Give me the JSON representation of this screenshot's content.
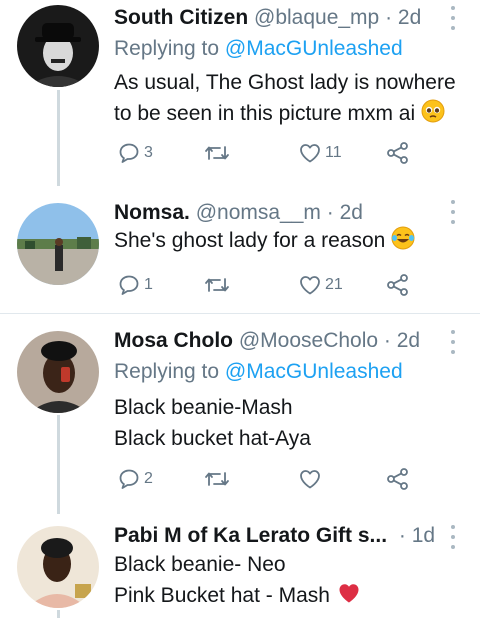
{
  "tweets": [
    {
      "name": "South Citizen",
      "handle": "@blaque_mp",
      "dot": "·",
      "time": "2d",
      "replying_label": "Replying to",
      "replying_to": "@MacGUnleashed",
      "lines": [
        "As usual, The Ghost lady is nowhere",
        "to be seen in this picture mxm ai"
      ],
      "emoji": "pleading-face-emoji",
      "counts": {
        "reply": "3",
        "retweet": "",
        "like": "11"
      }
    },
    {
      "name": "Nomsa.",
      "handle": "@nomsa__m",
      "dot": "·",
      "time": "2d",
      "lines": [
        "She's ghost lady for a reason"
      ],
      "emoji": "tears-of-joy-emoji",
      "counts": {
        "reply": "1",
        "retweet": "",
        "like": "21"
      }
    },
    {
      "name": "Mosa Cholo",
      "handle": "@MooseCholo",
      "dot": "·",
      "time": "2d",
      "replying_label": "Replying to",
      "replying_to": "@MacGUnleashed",
      "lines": [
        "Black beanie-Mash",
        "Black bucket hat-Aya"
      ],
      "counts": {
        "reply": "2",
        "retweet": "",
        "like": ""
      }
    },
    {
      "name": "Pabi M of Ka Lerato Gift s...",
      "handle": "",
      "dot": "·",
      "time": "1d",
      "lines": [
        "Black beanie- Neo",
        "Pink Bucket hat - Mash"
      ],
      "emoji": "red-heart-emoji"
    }
  ],
  "colors": {
    "accent": "#1da1f2",
    "secondary_text": "#657786",
    "primary_text": "#14171a",
    "divider": "#e1e8ed",
    "heart": "#e0245e"
  }
}
